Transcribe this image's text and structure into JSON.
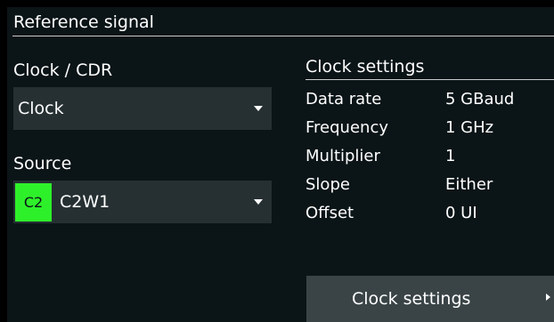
{
  "header": {
    "title": "Reference signal"
  },
  "clock_cdr": {
    "label": "Clock / CDR",
    "selected": "Clock"
  },
  "source": {
    "label": "Source",
    "channel_badge": "C2",
    "badge_color": "#2ef02a",
    "selected": "C2W1"
  },
  "clock_settings": {
    "title": "Clock settings",
    "rows": [
      {
        "name": "Data rate",
        "value": "5 GBaud"
      },
      {
        "name": "Frequency",
        "value": "1 GHz"
      },
      {
        "name": "Multiplier",
        "value": "1"
      },
      {
        "name": "Slope",
        "value": "Either"
      },
      {
        "name": "Offset",
        "value": "0 UI"
      }
    ],
    "button_label": "Clock settings",
    "button_icon": "arrow-right-icon"
  },
  "colors": {
    "background": "#0b1417",
    "control": "#263033",
    "button": "#3a4447",
    "rule": "#c8cccd"
  }
}
